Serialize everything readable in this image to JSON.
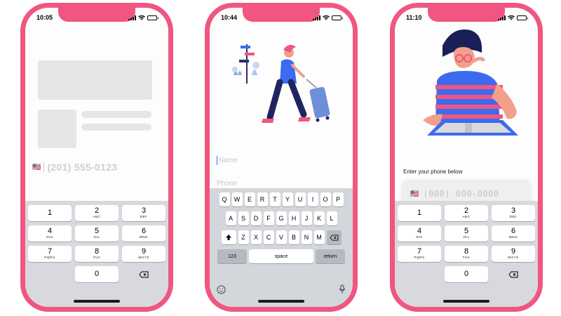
{
  "phones": [
    {
      "time": "10:05",
      "phone_field": {
        "flag": "🇺🇸",
        "placeholder": "(201) 555-0123"
      }
    },
    {
      "time": "10:44",
      "fields": {
        "name_placeholder": "Name",
        "phone_placeholder": "Phone"
      },
      "keyboard": {
        "row1": [
          "Q",
          "W",
          "E",
          "R",
          "T",
          "Y",
          "U",
          "I",
          "O",
          "P"
        ],
        "row2": [
          "A",
          "S",
          "D",
          "F",
          "G",
          "H",
          "J",
          "K",
          "L"
        ],
        "row3": [
          "Z",
          "X",
          "C",
          "V",
          "B",
          "N",
          "M"
        ],
        "num_key": "123",
        "space_key": "space",
        "return_key": "return",
        "shift_icon": "shift-icon",
        "delete_icon": "backspace-icon",
        "emoji_icon": "emoji-icon",
        "mic_icon": "microphone-icon"
      }
    },
    {
      "time": "11:10",
      "label": "Enter your phone below",
      "phone_field": {
        "flag": "🇺🇸",
        "mask": "(000) 000-0000"
      }
    }
  ],
  "numpad": {
    "keys": [
      {
        "digit": "1",
        "letters": ""
      },
      {
        "digit": "2",
        "letters": "ABC"
      },
      {
        "digit": "3",
        "letters": "DEF"
      },
      {
        "digit": "4",
        "letters": "GHI"
      },
      {
        "digit": "5",
        "letters": "JKL"
      },
      {
        "digit": "6",
        "letters": "MNO"
      },
      {
        "digit": "7",
        "letters": "PQRS"
      },
      {
        "digit": "8",
        "letters": "TUV"
      },
      {
        "digit": "9",
        "letters": "WXYZ"
      },
      {
        "digit": "0",
        "letters": ""
      }
    ],
    "delete_icon": "backspace-icon"
  },
  "colors": {
    "frame": "#f0567f",
    "keyboard_bg": "#d7d9de",
    "accent_blue": "#3c6bf0"
  }
}
